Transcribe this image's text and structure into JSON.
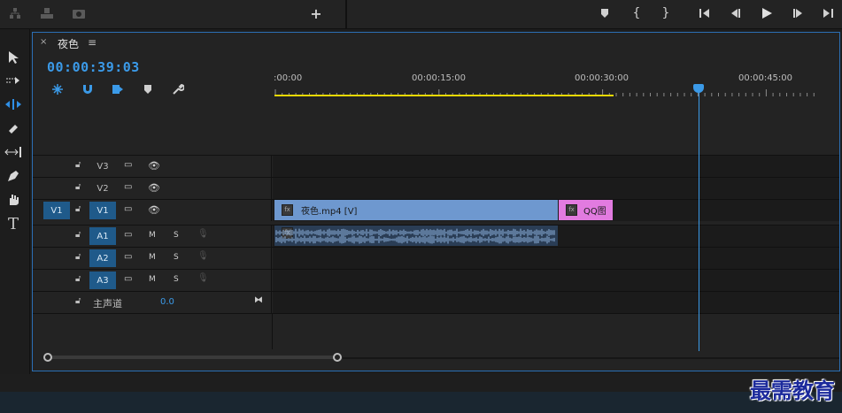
{
  "topbar": {
    "left_icons": [
      "hierarchy-icon",
      "export-icon",
      "camera-icon"
    ],
    "add_label": "+",
    "right_icons": [
      "marker-icon",
      "mark-in-icon",
      "mark-out-icon",
      "go-to-in-icon",
      "step-back-icon",
      "play-icon",
      "step-forward-icon",
      "go-to-out-icon"
    ]
  },
  "tools": [
    "selection-tool-icon",
    "track-select-tool-icon",
    "ripple-edit-tool-icon",
    "razor-tool-icon",
    "slip-tool-icon",
    "pen-tool-icon",
    "hand-tool-icon",
    "type-tool-icon"
  ],
  "panel": {
    "close": "×",
    "sequence_name": "夜色",
    "menu": "≡",
    "timecode": "00:00:39:03",
    "controls": [
      "nest-icon",
      "snap-icon",
      "linked-selection-icon",
      "add-marker-icon",
      "settings-wrench-icon"
    ]
  },
  "ruler": {
    "labels": [
      ":00:00",
      "00:00:15:00",
      "00:00:30:00",
      "00:00:45:00"
    ]
  },
  "tracks": {
    "video": [
      {
        "source": "",
        "name": "V3"
      },
      {
        "source": "",
        "name": "V2"
      },
      {
        "source": "V1",
        "name": "V1"
      }
    ],
    "audio": [
      {
        "name": "A1",
        "m": "M",
        "s": "S"
      },
      {
        "name": "A2",
        "m": "M",
        "s": "S"
      },
      {
        "name": "A3",
        "m": "M",
        "s": "S"
      }
    ],
    "master": {
      "label": "主声道",
      "value": "0.0"
    }
  },
  "clips": {
    "video1": {
      "label": "夜色.mp4 [V]",
      "color": "#6e98cf"
    },
    "video2": {
      "label": "QQ图",
      "color": "#e27be0"
    },
    "audio_color": "#6e98cf"
  },
  "colors": {
    "accent": "#3b9ae8",
    "workarea": "#e8d800"
  },
  "watermark": "最需教育"
}
